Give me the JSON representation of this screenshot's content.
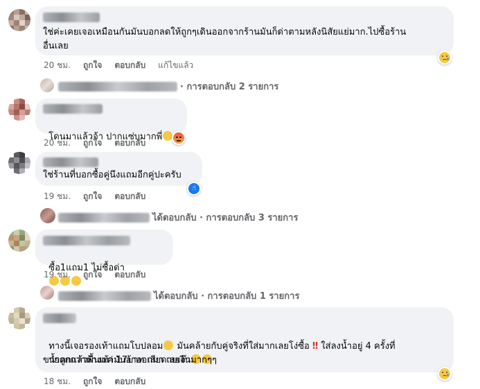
{
  "comments": [
    {
      "text": "ใช่ค่ะเคยเจอเหมือนกันมันบอกลดให้ถูกๆเดินออกจากร้านมันก็ด่าตามหลังนิสัยแย่มาก.ไปซื้อร้าน\nอื่นเลย",
      "time": "20 ชม.",
      "like": "ถูกใจ",
      "reply": "ตอบกลับ",
      "edited": "แก้ไขแล้ว",
      "reaction": "sad",
      "replies_summary": "· การตอบกลับ 2 รายการ"
    },
    {
      "text": "โดนมาแล้วจ้า ปากแซ่บมากพี่",
      "time": "20 ชม.",
      "like": "ถูกใจ",
      "reply": "ตอบกลับ",
      "reaction": "angry"
    },
    {
      "text": "ใช่ร้านที่บอกซื้อคู่นึงแถมอีกคู่ปะครับ",
      "time": "19 ชม.",
      "like": "ถูกใจ",
      "reply": "ตอบกลับ",
      "reaction": "like",
      "replies_summary": "ได้ตอบกลับ · การตอบกลับ 3 รายการ"
    },
    {
      "text": "ซื้อ1แถม1 ไม่ซื้อด่า",
      "time": "19 ชม.",
      "like": "ถูกใจ",
      "reply": "ตอบกลับ",
      "replies_summary": "ได้ตอบกลับ · การตอบกลับ 1 รายการ"
    },
    {
      "text_line1": "ทางนี้เจอรองเท้าแถมโบปลอม",
      "text_line1b": " มันคล้ายกับคู่จริงที่ใส่มากเลยโง่ซื้อ ",
      "text_line1c": " ใส่ลงน้ำอยู่ 4 ครั้งที่",
      "text_line2": "น้ำตกแล้วพื้นเท้ามันอ้าออกมา เลยจ๊า",
      "text_line3": "ขายถูกกว่าห้างแค่ 17บาท เสียดายเงินมากๆๆ",
      "time": "18 ชม.",
      "like": "ถูกใจ",
      "reply": "ตอบกลับ",
      "reaction": "sad"
    }
  ],
  "colors": {
    "bubble": "#f0f2f5",
    "meta": "#65676b",
    "like_blue": "#1877f2",
    "angry_red": "#e9573f",
    "emoji_yellow": "#f7c843"
  },
  "icons": {
    "sad": "sad-reaction-icon",
    "angry": "angry-reaction-icon",
    "like": "like-reaction-icon",
    "laugh": "laugh-emoji",
    "exclaim": "double-exclamation-emoji"
  }
}
